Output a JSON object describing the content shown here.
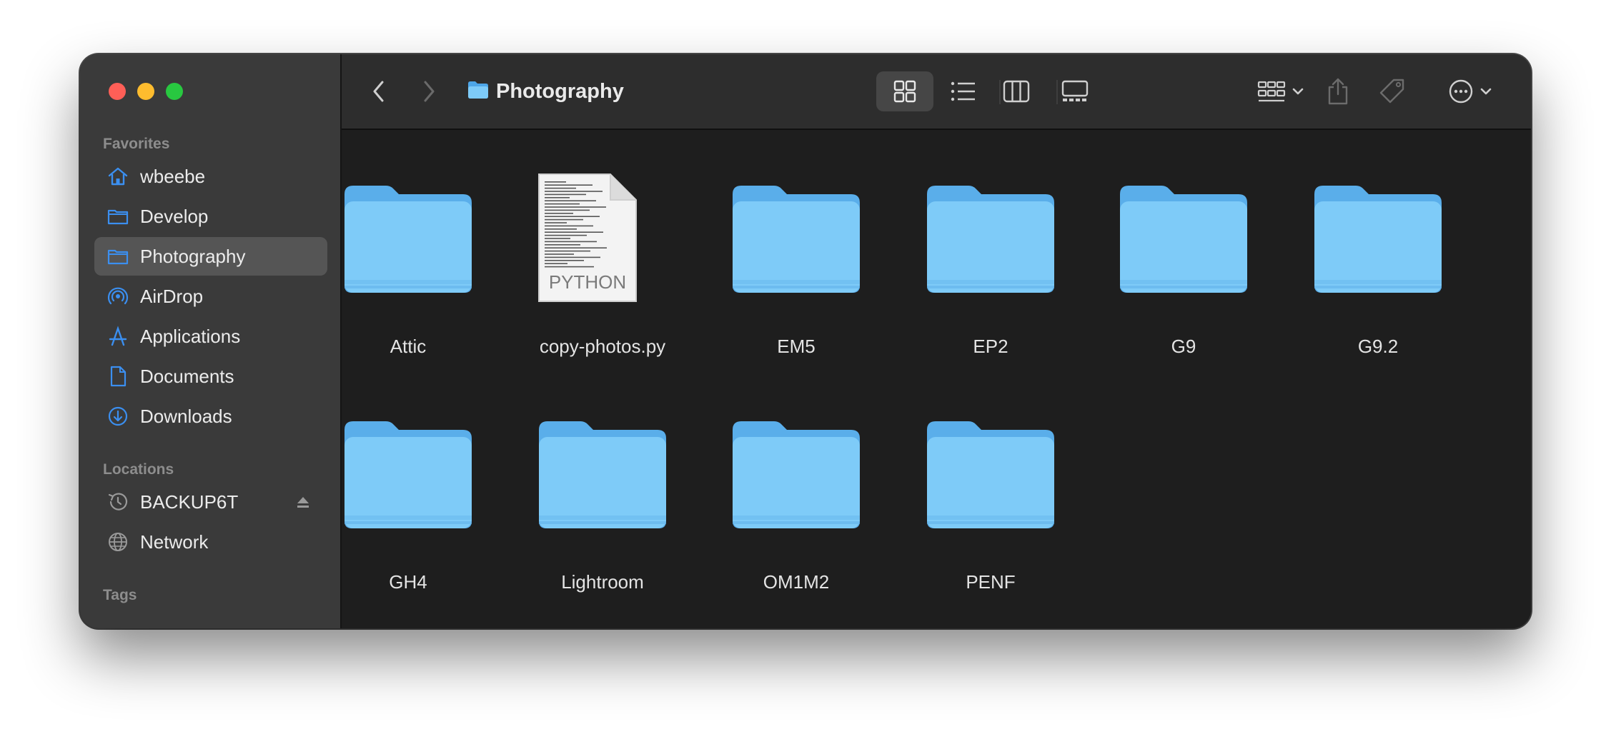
{
  "window": {
    "title": "Photography"
  },
  "sidebar": {
    "favorites_label": "Favorites",
    "favorites": [
      {
        "label": "wbeebe",
        "icon": "home-icon"
      },
      {
        "label": "Develop",
        "icon": "folder-icon"
      },
      {
        "label": "Photography",
        "icon": "folder-icon",
        "selected": true
      },
      {
        "label": "AirDrop",
        "icon": "airdrop-icon"
      },
      {
        "label": "Applications",
        "icon": "applications-icon"
      },
      {
        "label": "Documents",
        "icon": "document-icon"
      },
      {
        "label": "Downloads",
        "icon": "download-icon"
      }
    ],
    "locations_label": "Locations",
    "locations": [
      {
        "label": "BACKUP6T",
        "icon": "time-machine-icon",
        "ejectable": true
      },
      {
        "label": "Network",
        "icon": "globe-icon"
      }
    ],
    "tags_label": "Tags"
  },
  "toolbar": {
    "back_icon": "chevron-left-icon",
    "forward_icon": "chevron-right-icon",
    "active_view": "icon",
    "views": [
      "icon-view-icon",
      "list-view-icon",
      "column-view-icon",
      "gallery-view-icon"
    ]
  },
  "items": [
    {
      "name": "Attic",
      "kind": "folder"
    },
    {
      "name": "copy-photos.py",
      "kind": "python",
      "badge": "PYTHON"
    },
    {
      "name": "EM5",
      "kind": "folder"
    },
    {
      "name": "EP2",
      "kind": "folder"
    },
    {
      "name": "G9",
      "kind": "folder"
    },
    {
      "name": "G9.2",
      "kind": "folder"
    },
    {
      "name": "GH4",
      "kind": "folder"
    },
    {
      "name": "Lightroom",
      "kind": "folder"
    },
    {
      "name": "OM1M2",
      "kind": "folder"
    },
    {
      "name": "PENF",
      "kind": "folder"
    }
  ],
  "colors": {
    "accent": "#3b8ff0",
    "folder_top": "#5eb3ec",
    "folder_front": "#7ecbf8"
  }
}
